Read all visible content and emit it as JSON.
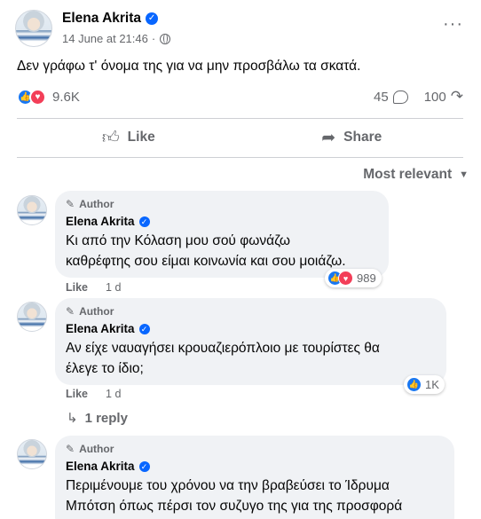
{
  "post": {
    "author": "Elena Akrita",
    "timestamp": "14 June at 21:46",
    "separator": "·",
    "text": "Δεν γράφω τ' όνομα της για να μην προσβάλω τα σκατά.",
    "reaction_count": "9.6K",
    "comment_count": "45",
    "share_count": "100"
  },
  "actions": {
    "like_label": "Like",
    "share_label": "Share"
  },
  "sort": {
    "label": "Most relevant"
  },
  "comments": [
    {
      "tag": "Author",
      "name": "Elena Akrita",
      "lines": [
        "Κι από την Κόλαση μου σού φωνάζω",
        "καθρέφτης σου είμαι κοινωνία και σου μοιάζω."
      ],
      "like_label": "Like",
      "age": "1 d",
      "reactions": "989"
    },
    {
      "tag": "Author",
      "name": "Elena Akrita",
      "lines": [
        "Αν είχε ναυαγήσει κρουαζιερόπλοιο με τουρίστες θα",
        "έλεγε το ίδιο;"
      ],
      "like_label": "Like",
      "age": "1 d",
      "reactions": "1K",
      "reply_label": "1 reply"
    },
    {
      "tag": "Author",
      "name": "Elena Akrita",
      "lines": [
        "Περιμένουμε του χρόνου να την βραβεύσει το Ίδρυμα",
        "Μπότση όπως πέρσι τον συζυγο της για της προσφορά"
      ]
    }
  ],
  "colors": {
    "accent": "#0866ff",
    "like_blue": "#1877f2",
    "love_red": "#f33e58",
    "muted": "#65676b",
    "bubble": "#f0f2f5"
  }
}
